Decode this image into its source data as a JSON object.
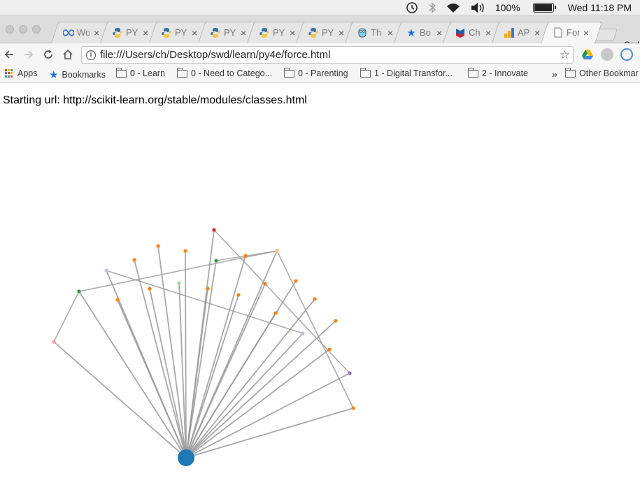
{
  "menubar": {
    "battery_percent": "100%",
    "battery_level": 1.0,
    "clock": "Wed 11:18 PM"
  },
  "tabs": [
    {
      "title": "Wo",
      "icon": "infinity-icon",
      "active": false
    },
    {
      "title": "PY",
      "icon": "python-icon",
      "active": false
    },
    {
      "title": "PY",
      "icon": "python-icon",
      "active": false
    },
    {
      "title": "PY",
      "icon": "python-icon",
      "active": false
    },
    {
      "title": "PY",
      "icon": "python-icon",
      "active": false
    },
    {
      "title": "PY",
      "icon": "python-icon",
      "active": false
    },
    {
      "title": "Th",
      "icon": "gopher-icon",
      "active": false
    },
    {
      "title": "Bo",
      "icon": "star-icon",
      "active": false
    },
    {
      "title": "Ch",
      "icon": "chevron-logo-icon",
      "active": false
    },
    {
      "title": "AP",
      "icon": "analytics-icon",
      "active": false
    },
    {
      "title": "For",
      "icon": "page-icon",
      "active": true
    }
  ],
  "profile_name": "Carl",
  "toolbar": {
    "url": "file:///Users/ch/Desktop/swd/learn/py4e/force.html"
  },
  "bookmarks": {
    "apps": "Apps",
    "bookmarks": "Bookmarks",
    "folders": [
      "0 - Learn",
      "0 - Need to Catego...",
      "0 - Parenting",
      "1 - Digital Transfor...",
      "2 - Innovate"
    ],
    "overflow": "»",
    "other": "Other Bookmar"
  },
  "page": {
    "starting_url_text": "Starting url: http://scikit-learn.org/stable/modules/classes.html"
  },
  "graph": {
    "hub": {
      "color": "#1f77b4"
    },
    "nodes": [
      {
        "id": "n1",
        "color": "#d62728"
      },
      {
        "id": "n2",
        "color": "#ff7f0e"
      },
      {
        "id": "n3",
        "color": "#ffbb78"
      },
      {
        "id": "n4",
        "color": "#ff7f0e"
      },
      {
        "id": "n5",
        "color": "#ff7f0e"
      },
      {
        "id": "n6",
        "color": "#ff7f0e"
      },
      {
        "id": "n7",
        "color": "#aec7e8"
      },
      {
        "id": "n8",
        "color": "#2ca02c"
      },
      {
        "id": "n9",
        "color": "#ff7f0e"
      },
      {
        "id": "n10",
        "color": "#ff7f0e"
      },
      {
        "id": "n11",
        "color": "#98df8a"
      },
      {
        "id": "n12",
        "color": "#ff7f0e"
      },
      {
        "id": "n13",
        "color": "#ff7f0e"
      },
      {
        "id": "n14",
        "color": "#ff7f0e"
      },
      {
        "id": "n15",
        "color": "#ff7f0e"
      },
      {
        "id": "n16",
        "color": "#2ca02c"
      },
      {
        "id": "n17",
        "color": "#ff7f0e"
      },
      {
        "id": "n18",
        "color": "#ff7f0e"
      },
      {
        "id": "n19",
        "color": "#aec7e8"
      },
      {
        "id": "n20",
        "color": "#ff7f0e"
      },
      {
        "id": "n21",
        "color": "#ff9896"
      },
      {
        "id": "n22",
        "color": "#ff7f0e"
      },
      {
        "id": "n23",
        "color": "#9467bd"
      },
      {
        "id": "n24",
        "color": "#ff7f0e"
      }
    ],
    "extra_links": [
      [
        "n1",
        "n23"
      ],
      [
        "n3",
        "n8"
      ],
      [
        "n3",
        "n16"
      ],
      [
        "n3",
        "n24"
      ],
      [
        "n7",
        "n19"
      ],
      [
        "n16",
        "n21"
      ]
    ],
    "link_color": "#999999"
  }
}
